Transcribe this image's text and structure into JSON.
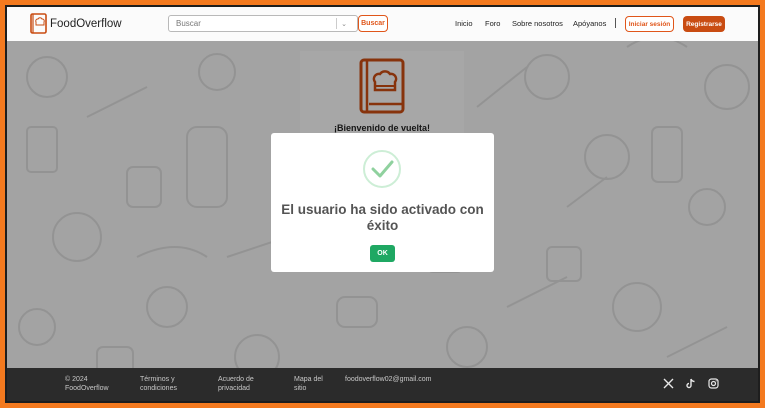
{
  "colors": {
    "frame": "#f47a1f",
    "accent": "#e0561a",
    "register_bg": "#c94c12",
    "ok": "#1fa863",
    "footer_bg": "#2b2b2b"
  },
  "header": {
    "brand": "FoodOverflow",
    "search": {
      "placeholder": "Buscar",
      "button": "Buscar"
    },
    "nav": [
      "Inicio",
      "Foro",
      "Sobre nosotros",
      "Apóyanos"
    ],
    "login": "Iniciar sesión",
    "register": "Registrarse"
  },
  "card": {
    "title": "¡Bienvenido de vuelta!",
    "icon": "cookbook-chef-icon"
  },
  "modal": {
    "message": "El usuario ha sido activado con éxito",
    "ok": "OK",
    "icon": "success-check-icon"
  },
  "footer": {
    "copyright": "© 2024 FoodOverflow",
    "links": [
      "Términos y condiciones",
      "Acuerdo de privacidad",
      "Mapa del sitio"
    ],
    "email": "foodoverflow02@gmail.com",
    "social": [
      "x-icon",
      "tiktok-icon",
      "instagram-icon"
    ]
  }
}
